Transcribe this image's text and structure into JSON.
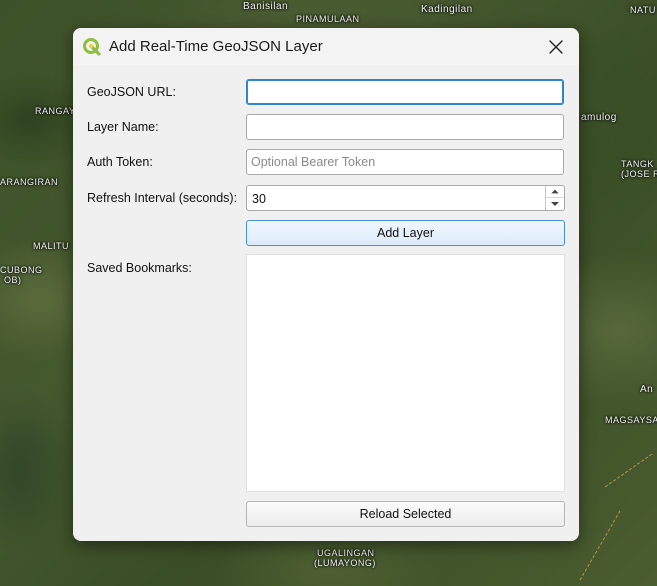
{
  "map": {
    "labels": [
      "Banisilan",
      "PINAMULAAN",
      "Kadingilan",
      "NATU",
      "RANGAY",
      "amulog",
      "TANGK",
      "(JOSE R",
      "ARANGIRAN",
      "MALITU",
      "CUBONG",
      "OB)",
      "An",
      "MAGSAYSA",
      "UGALINGAN",
      "(LUMAYONG)"
    ]
  },
  "dialog": {
    "title": "Add Real-Time GeoJSON Layer",
    "app_icon": "qgis-logo-icon",
    "close_icon": "close-icon"
  },
  "form": {
    "url_label": "GeoJSON URL:",
    "url_value": "",
    "url_placeholder": "",
    "layer_name_label": "Layer Name:",
    "layer_name_value": "",
    "auth_label": "Auth Token:",
    "auth_value": "",
    "auth_placeholder": "Optional Bearer Token",
    "refresh_label": "Refresh Interval (seconds):",
    "refresh_value": "30",
    "add_layer_label": "Add Layer",
    "bookmarks_label": "Saved Bookmarks:",
    "bookmarks": [],
    "reload_label": "Reload Selected"
  },
  "colors": {
    "accent": "#2f86d0",
    "qgis_green": "#8cbf3f"
  }
}
